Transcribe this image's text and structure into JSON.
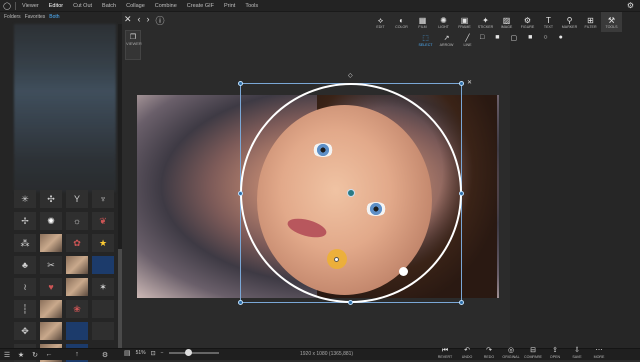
{
  "menu": {
    "items": [
      "Viewer",
      "Editor",
      "Cut Out",
      "Batch",
      "Collage",
      "Combine",
      "Create GIF",
      "Print",
      "Tools"
    ],
    "active": "Editor"
  },
  "left_panel": {
    "tabs": [
      "Folders",
      "Favorites",
      "Both"
    ],
    "active_tab": "Both"
  },
  "view_button_label": "VIEWER",
  "toolbar": [
    {
      "label": "EDIT",
      "icon": "crop-icon",
      "glyph": "⟡"
    },
    {
      "label": "COLOR",
      "icon": "color-icon",
      "glyph": "◐"
    },
    {
      "label": "FILM",
      "icon": "film-icon",
      "glyph": "▦"
    },
    {
      "label": "LIGHT",
      "icon": "light-icon",
      "glyph": "✺"
    },
    {
      "label": "FRAME",
      "icon": "frame-icon",
      "glyph": "▣"
    },
    {
      "label": "STICKER",
      "icon": "sticker-icon",
      "glyph": "✦"
    },
    {
      "label": "IMAGE",
      "icon": "image-icon",
      "glyph": "▨"
    },
    {
      "label": "FIGURE",
      "icon": "figure-icon",
      "glyph": "⚙"
    },
    {
      "label": "TEXT",
      "icon": "text-icon",
      "glyph": "T"
    },
    {
      "label": "MARKER",
      "icon": "marker-icon",
      "glyph": "⚲"
    },
    {
      "label": "FILTER",
      "icon": "filter-icon",
      "glyph": "⊞"
    },
    {
      "label": "TOOLS",
      "icon": "tools-icon",
      "glyph": "⚒"
    }
  ],
  "subtools": [
    {
      "label": "SELECT",
      "glyph": "⬚",
      "active": true
    },
    {
      "label": "ARROW",
      "glyph": "↗",
      "active": false
    },
    {
      "label": "LINE",
      "glyph": "╱",
      "active": false
    }
  ],
  "shapes": [
    "□",
    "■",
    "▢",
    "■",
    "○",
    "●"
  ],
  "zoom": {
    "value": "51%"
  },
  "image_info": "1920 x 1080 (1365,881)",
  "actions": [
    {
      "label": "REVERT",
      "glyph": "⏮"
    },
    {
      "label": "UNDO",
      "glyph": "↶"
    },
    {
      "label": "REDO",
      "glyph": "↷"
    },
    {
      "label": "ORIGINAL",
      "glyph": "◎"
    },
    {
      "label": "COMPARE",
      "glyph": "⊟"
    },
    {
      "label": "OPEN",
      "glyph": "⇪"
    },
    {
      "label": "SAVE",
      "glyph": "⇩"
    },
    {
      "label": "MORE",
      "glyph": "⋯"
    }
  ]
}
